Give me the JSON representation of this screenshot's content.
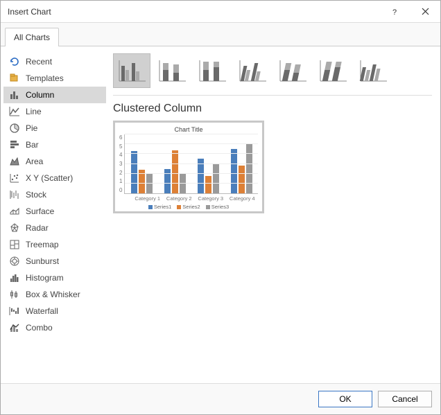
{
  "window": {
    "title": "Insert Chart"
  },
  "tabs": {
    "main": "All Charts"
  },
  "sidebar": {
    "items": [
      {
        "label": "Recent",
        "icon": "recent-icon"
      },
      {
        "label": "Templates",
        "icon": "templates-icon"
      },
      {
        "label": "Column",
        "icon": "column-icon",
        "selected": true
      },
      {
        "label": "Line",
        "icon": "line-icon"
      },
      {
        "label": "Pie",
        "icon": "pie-icon"
      },
      {
        "label": "Bar",
        "icon": "bar-icon"
      },
      {
        "label": "Area",
        "icon": "area-icon"
      },
      {
        "label": "X Y (Scatter)",
        "icon": "scatter-icon"
      },
      {
        "label": "Stock",
        "icon": "stock-icon"
      },
      {
        "label": "Surface",
        "icon": "surface-icon"
      },
      {
        "label": "Radar",
        "icon": "radar-icon"
      },
      {
        "label": "Treemap",
        "icon": "treemap-icon"
      },
      {
        "label": "Sunburst",
        "icon": "sunburst-icon"
      },
      {
        "label": "Histogram",
        "icon": "histogram-icon"
      },
      {
        "label": "Box & Whisker",
        "icon": "box-whisker-icon"
      },
      {
        "label": "Waterfall",
        "icon": "waterfall-icon"
      },
      {
        "label": "Combo",
        "icon": "combo-icon"
      }
    ]
  },
  "subtypes": [
    {
      "name": "clustered-column",
      "selected": true
    },
    {
      "name": "stacked-column"
    },
    {
      "name": "stacked-100-column"
    },
    {
      "name": "clustered-column-3d"
    },
    {
      "name": "stacked-column-3d"
    },
    {
      "name": "stacked-100-column-3d"
    },
    {
      "name": "column-3d"
    }
  ],
  "main": {
    "subtitle": "Clustered Column"
  },
  "chart_data": {
    "type": "bar",
    "title": "Chart Title",
    "categories": [
      "Category 1",
      "Category 2",
      "Category 3",
      "Category 4"
    ],
    "series": [
      {
        "name": "Series1",
        "values": [
          4.3,
          2.5,
          3.5,
          4.5
        ],
        "color": "#4a7ebb"
      },
      {
        "name": "Series2",
        "values": [
          2.4,
          4.4,
          1.8,
          2.8
        ],
        "color": "#dd8036"
      },
      {
        "name": "Series3",
        "values": [
          2.0,
          2.0,
          3.0,
          5.0
        ],
        "color": "#9a9a9a"
      }
    ],
    "xlabel": "",
    "ylabel": "",
    "ylim": [
      0,
      6
    ],
    "yticks": [
      0,
      1,
      2,
      3,
      4,
      5,
      6
    ]
  },
  "footer": {
    "ok": "OK",
    "cancel": "Cancel"
  }
}
